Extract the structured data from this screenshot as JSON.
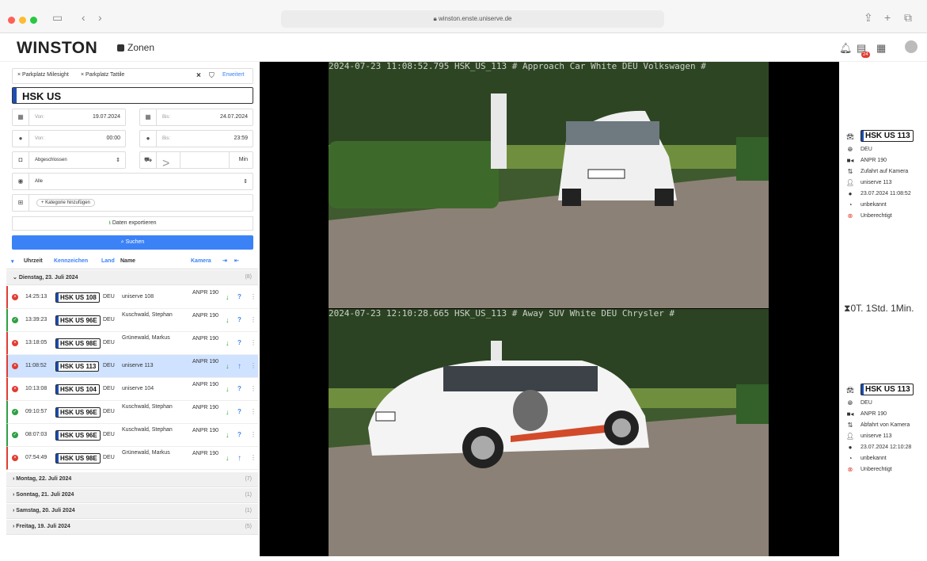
{
  "browser": {
    "url": "winston.enste.uniserve.de"
  },
  "app": {
    "logo": "WINSTON",
    "section": "Zonen",
    "notif_count": "24"
  },
  "filters": {
    "chips": [
      "× Parkplatz Milesight",
      "× Parkplatz Tattile"
    ],
    "advanced": "Erweitert",
    "plate": "HSK US",
    "from_label": "Von:",
    "from_date": "19.07.2024",
    "to_label": "Bis:",
    "to_date": "24.07.2024",
    "from_time": "00:00",
    "to_time": "23:59",
    "status": "Abgeschlossen",
    "cmp": ">",
    "unit": "Min",
    "category": "Alle",
    "add_category": "+ Kategorie hinzufügen",
    "export": "Daten exportieren",
    "search": "Suchen"
  },
  "table": {
    "headers": {
      "time": "Uhrzeit",
      "plate": "Kennzeichen",
      "country": "Land",
      "name": "Name",
      "camera": "Kamera"
    },
    "groups": [
      {
        "label": "Dienstag, 23. Juli 2024",
        "count": "(8)"
      },
      {
        "label": "Montag, 22. Juli 2024",
        "count": "(7)"
      },
      {
        "label": "Sonntag, 21. Juli 2024",
        "count": "(1)"
      },
      {
        "label": "Samstag, 20. Juli 2024",
        "count": "(1)"
      },
      {
        "label": "Freitag, 19. Juli 2024",
        "count": "(5)"
      }
    ],
    "rows": [
      {
        "time": "14:25:13",
        "plate": "HSK US 108",
        "country": "DEU",
        "name": "uniserve 108",
        "camera": "ANPR 190",
        "status": "denied",
        "dir": "in"
      },
      {
        "time": "13:39:23",
        "plate": "HSK US 96E",
        "country": "DEU",
        "name": "Kuschwald, Stephan",
        "camera": "ANPR 190",
        "status": "ok",
        "dir": "in"
      },
      {
        "time": "13:18:05",
        "plate": "HSK US 98E",
        "country": "DEU",
        "name": "Grünewald, Markus",
        "camera": "ANPR 190",
        "status": "denied",
        "dir": "in"
      },
      {
        "time": "11:08:52",
        "plate": "HSK US 113",
        "country": "DEU",
        "name": "uniserve 113",
        "camera": "ANPR 190",
        "status": "denied",
        "dir": "both"
      },
      {
        "time": "10:13:08",
        "plate": "HSK US 104",
        "country": "DEU",
        "name": "uniserve 104",
        "camera": "ANPR 190",
        "status": "denied",
        "dir": "in"
      },
      {
        "time": "09:10:57",
        "plate": "HSK US 96E",
        "country": "DEU",
        "name": "Kuschwald, Stephan",
        "camera": "ANPR 190",
        "status": "ok",
        "dir": "in"
      },
      {
        "time": "08:07:03",
        "plate": "HSK US 96E",
        "country": "DEU",
        "name": "Kuschwald, Stephan",
        "camera": "ANPR 190",
        "status": "ok",
        "dir": "in"
      },
      {
        "time": "07:54:49",
        "plate": "HSK US 98E",
        "country": "DEU",
        "name": "Grünewald, Markus",
        "camera": "ANPR 190",
        "status": "denied",
        "dir": "both"
      }
    ]
  },
  "images": {
    "top_stamp": "2024-07-23 11:08:52.795 HSK_US_113 # Approach Car White DEU Volkswagen #",
    "bottom_stamp": "2024-07-23 12:10:28.665 HSK_US_113 # Away SUV White DEU Chrysler #"
  },
  "detail_top": {
    "plate": "HSK US 113",
    "country": "DEU",
    "camera": "ANPR 190",
    "direction": "Zufahrt auf Kamera",
    "owner": "uniserve 113",
    "time": "23.07.2024 11:08:52",
    "speed": "unbekannt",
    "auth": "Unberechtigt"
  },
  "duration": "0T. 1Std. 1Min.",
  "detail_bottom": {
    "plate": "HSK US 113",
    "country": "DEU",
    "camera": "ANPR 190",
    "direction": "Abfahrt von Kamera",
    "owner": "uniserve 113",
    "time": "23.07.2024 12:10:28",
    "speed": "unbekannt",
    "auth": "Unberechtigt"
  }
}
